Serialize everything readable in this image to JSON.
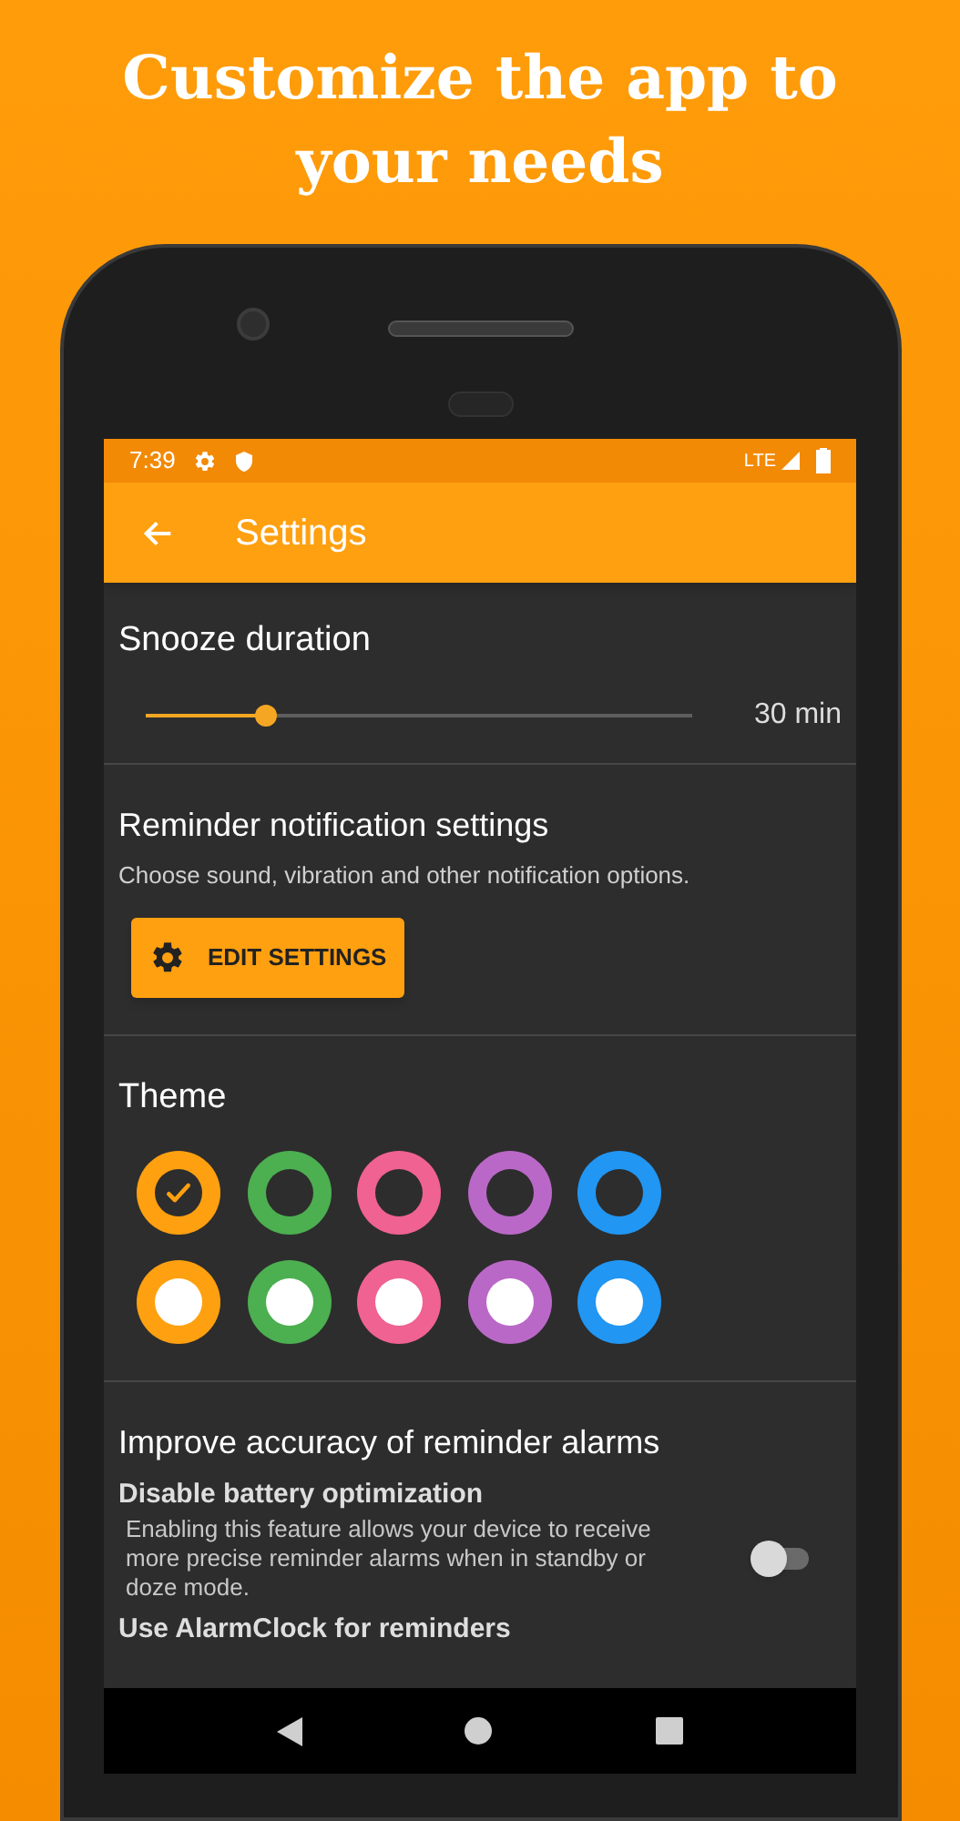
{
  "headline": "Customize the app to your needs",
  "status_bar": {
    "time": "7:39",
    "network": "LTE"
  },
  "toolbar": {
    "title": "Settings"
  },
  "snooze": {
    "title": "Snooze duration",
    "level": 0.22,
    "reading": "30 min"
  },
  "reminder": {
    "title": "Reminder notification settings",
    "subtitle": "Choose sound, vibration and other notification options.",
    "button": "EDIT SETTINGS"
  },
  "theme": {
    "title": "Theme",
    "swatches": [
      {
        "color": "#ffa010",
        "kind": "dark",
        "selected": true
      },
      {
        "color": "#4caf50",
        "kind": "dark",
        "selected": false
      },
      {
        "color": "#f06292",
        "kind": "dark",
        "selected": false
      },
      {
        "color": "#ba68c8",
        "kind": "dark",
        "selected": false
      },
      {
        "color": "#2196f3",
        "kind": "dark",
        "selected": false
      },
      {
        "color": "#ffa010",
        "kind": "light",
        "selected": false
      },
      {
        "color": "#4caf50",
        "kind": "light",
        "selected": false
      },
      {
        "color": "#f06292",
        "kind": "light",
        "selected": false
      },
      {
        "color": "#ba68c8",
        "kind": "light",
        "selected": false
      },
      {
        "color": "#2196f3",
        "kind": "light",
        "selected": false
      }
    ]
  },
  "accuracy": {
    "title": "Improve accuracy of reminder alarms",
    "options": [
      {
        "title": "Disable battery optimization",
        "description": "Enabling this feature allows your device to receive more precise reminder alarms when in standby or doze mode.",
        "on": false
      },
      {
        "title": "Use AlarmClock for reminders"
      }
    ]
  }
}
